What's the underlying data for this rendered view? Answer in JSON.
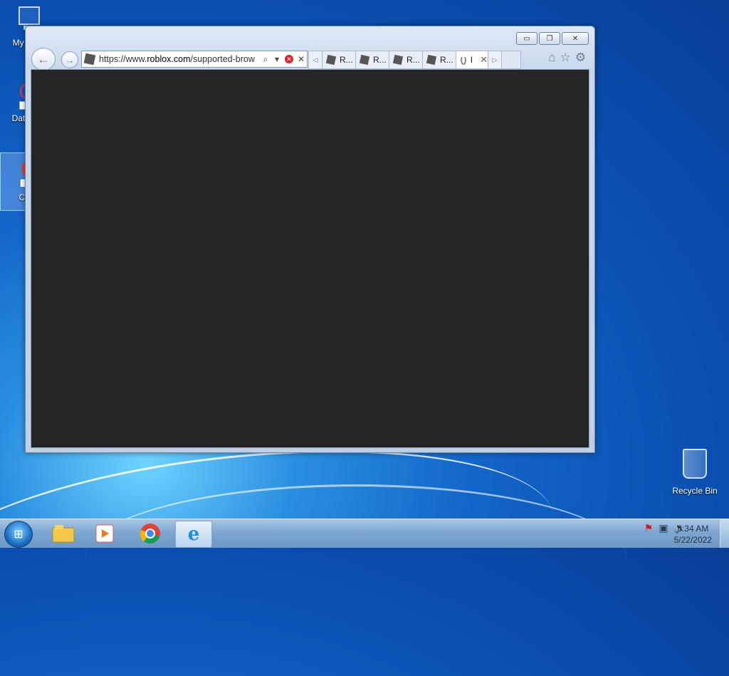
{
  "desktop": {
    "icons": [
      {
        "label": "My Co",
        "icon": "computer-icon"
      },
      {
        "label": "DataW",
        "icon": "datawatch-icon"
      },
      {
        "label": "Chr",
        "icon": "chrome-icon"
      }
    ],
    "recycle_bin": {
      "label": "Recycle Bin",
      "icon": "recycle-bin-icon"
    }
  },
  "browser": {
    "address_url_host": "https://www.",
    "address_url_domain": "roblox.com",
    "address_url_path": "/supported-brow",
    "tabs": [
      {
        "label": "R..."
      },
      {
        "label": "R..."
      },
      {
        "label": "R..."
      },
      {
        "label": "R..."
      }
    ],
    "active_tab": {
      "label": "I",
      "loading": true
    },
    "window_controls": {
      "minimize": "minimize-icon",
      "restore": "restore-icon",
      "close": "close-icon"
    },
    "content_bg": "#232527"
  },
  "taskbar": {
    "apps": [
      {
        "name": "windows-explorer-icon"
      },
      {
        "name": "media-player-icon"
      },
      {
        "name": "chrome-icon"
      },
      {
        "name": "internet-explorer-icon",
        "active": true
      }
    ],
    "tray": {
      "icons": [
        "action-center-flag-icon",
        "network-icon",
        "volume-icon"
      ]
    },
    "clock": {
      "time": "8:34 AM",
      "date": "5/22/2022"
    }
  }
}
